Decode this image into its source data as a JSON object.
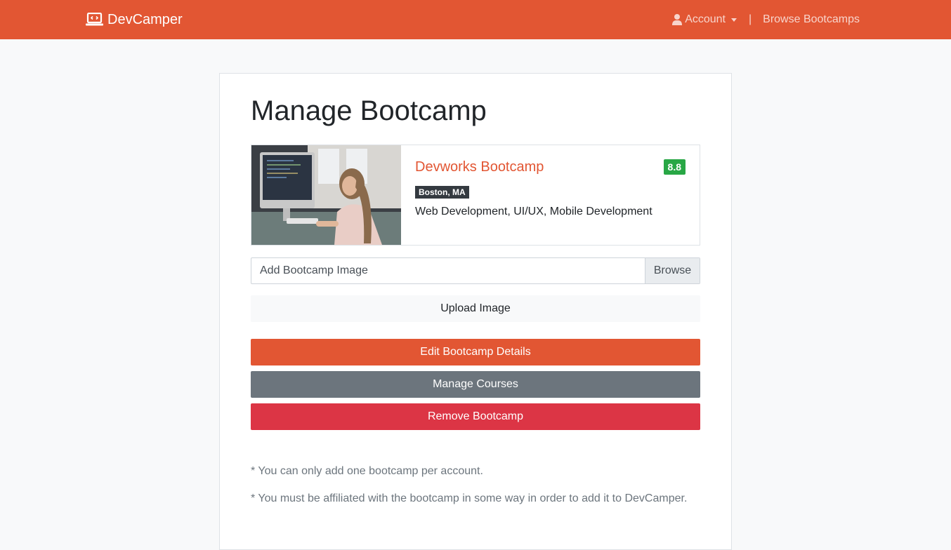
{
  "navbar": {
    "brand": "DevCamper",
    "account_label": "Account",
    "separator": "|",
    "browse_label": "Browse Bootcamps"
  },
  "page": {
    "title": "Manage Bootcamp"
  },
  "bootcamp": {
    "name": "Devworks Bootcamp",
    "rating": "8.8",
    "location": "Boston, MA",
    "careers": "Web Development, UI/UX, Mobile Development",
    "colors": {
      "title": "#e25633",
      "rating_badge": "#28a745"
    }
  },
  "upload": {
    "file_label": "Add Bootcamp Image",
    "browse_label": "Browse",
    "upload_button": "Upload Image"
  },
  "actions": {
    "edit_label": "Edit Bootcamp Details",
    "manage_courses_label": "Manage Courses",
    "remove_label": "Remove Bootcamp"
  },
  "notes": [
    "* You can only add one bootcamp per account.",
    "* You must be affiliated with the bootcamp in some way in order to add it to DevCamper."
  ],
  "icons": {
    "brand": "laptop-code-icon",
    "account": "user-icon",
    "dropdown": "caret-down-icon"
  },
  "theme": {
    "primary": "#e25633",
    "secondary": "#6c757d",
    "danger": "#dc3545"
  }
}
